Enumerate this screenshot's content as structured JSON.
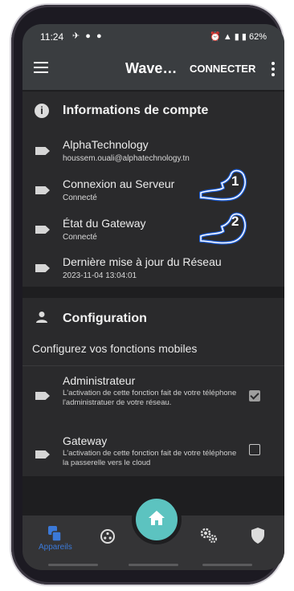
{
  "status_bar": {
    "time": "11:24",
    "left_icons": "✈ ● ●",
    "right_icons": "⏰ ▲ ▮ ▮ 62%"
  },
  "app_bar": {
    "title": "Wave…",
    "connect_label": "CONNECTER"
  },
  "account_card": {
    "title": "Informations de compte",
    "rows": [
      {
        "title": "AlphaTechnology",
        "subtitle": "houssem.ouali@alphatechnology.tn"
      },
      {
        "title": "Connexion au Serveur",
        "subtitle": "Connecté"
      },
      {
        "title": "État du Gateway",
        "subtitle": "Connecté"
      },
      {
        "title": "Dernière mise à jour du Réseau",
        "subtitle": "2023-11-04 13:04:01"
      }
    ]
  },
  "config_card": {
    "title": "Configuration",
    "subtitle": "Configurez vos fonctions mobiles",
    "items": [
      {
        "title": "Administrateur",
        "description": "L'activation de cette fonction fait de votre téléphone l'administratuer de votre réseau.",
        "checked": true
      },
      {
        "title": "Gateway",
        "description": "L'activation de cette fonction fait de votre téléphone la passerelle vers le cloud",
        "checked": false
      }
    ]
  },
  "annotations": [
    {
      "number": "1"
    },
    {
      "number": "2"
    }
  ],
  "bottom_nav": {
    "active_label": "Appareils",
    "items": [
      "devices-icon",
      "hub-icon",
      "home-icon",
      "settings-icon",
      "shield-icon"
    ]
  },
  "colors": {
    "fab": "#5cc3c0",
    "active_nav": "#3b79d8",
    "card": "#2a2a2c",
    "appbar": "#3a3d40"
  }
}
